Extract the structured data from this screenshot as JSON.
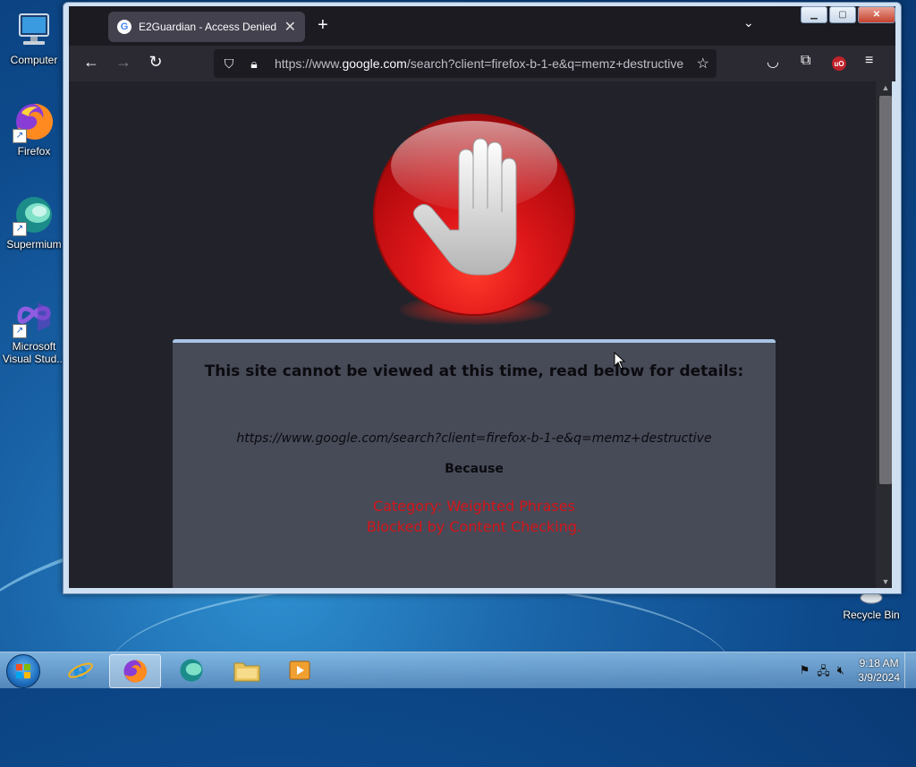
{
  "desktop": {
    "icons": [
      {
        "label": "Computer",
        "icon": "computer-icon"
      },
      {
        "label": "Firefox",
        "icon": "firefox-icon"
      },
      {
        "label": "Supermium",
        "icon": "supermium-icon"
      },
      {
        "label": "Microsoft Visual Stud...",
        "icon": "visual-studio-icon"
      },
      {
        "label": "Recycle Bin",
        "icon": "recycle-bin-icon"
      }
    ]
  },
  "browser": {
    "tab": {
      "title": "E2Guardian - Access Denied",
      "favicon": "google-favicon"
    },
    "url": {
      "prefix": "https://www.",
      "host": "google.com",
      "rest": "/search?client=firefox-b-1-e&q=memz+destructive"
    }
  },
  "page": {
    "title": "This site cannot be viewed at this time, read below for details:",
    "blocked_url": "https://www.google.com/search?client=firefox-b-1-e&q=memz+destructive",
    "because_label": "Because",
    "reason_line1": "Category: Weighted Phrases",
    "reason_line2": "Blocked by Content Checking."
  },
  "taskbar": {
    "items": [
      "internet-explorer-icon",
      "firefox-icon",
      "supermium-icon",
      "file-explorer-icon",
      "media-player-icon"
    ],
    "clock_time": "9:18 AM",
    "clock_date": "3/9/2024"
  },
  "colors": {
    "reason_text": "#d4161a",
    "panel_bg": "#474a57",
    "page_bg": "#22232a"
  }
}
